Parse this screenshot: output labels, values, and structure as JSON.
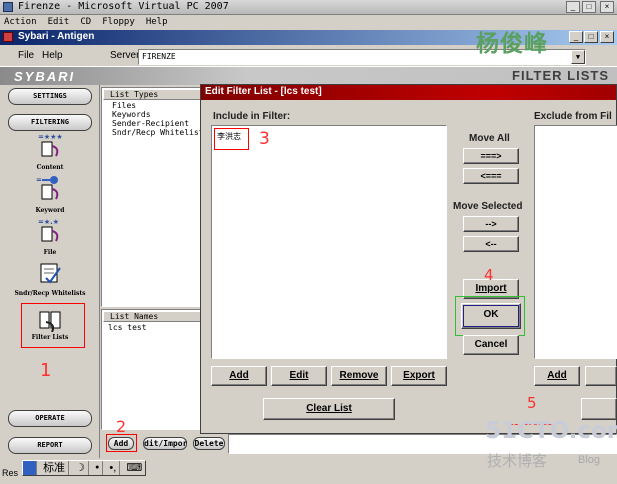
{
  "vpc": {
    "title": "Firenze - Microsoft Virtual PC 2007",
    "menu": [
      "Action",
      "Edit",
      "CD",
      "Floppy",
      "Help"
    ]
  },
  "app": {
    "title": "Sybari - Antigen",
    "menu": [
      "File",
      "Help"
    ],
    "server_label": "Server",
    "server_value": "FIRENZE",
    "brand": "SYBARI",
    "page_title": "FILTER LISTS"
  },
  "nav": {
    "settings": "SETTINGS",
    "filtering": "FILTERING",
    "items": [
      "Content",
      "Keyword",
      "File",
      "Sndr/Recp Whitelists",
      "Filter Lists"
    ],
    "operate": "OPERATE",
    "report": "REPORT"
  },
  "list_types": {
    "header": "List Types",
    "items": [
      "Files",
      "Keywords",
      "Sender-Recipient",
      "Sndr/Recp Whitelists"
    ]
  },
  "list_names": {
    "header": "List Names",
    "items": [
      "lcs test"
    ]
  },
  "bottom_buttons": [
    "Add",
    "dit/Impor",
    "Delete"
  ],
  "dialog": {
    "title": "Edit Filter List - [lcs test]",
    "include_label": "Include in Filter:",
    "include_items": [
      "李洪志"
    ],
    "exclude_label": "Exclude from Fil",
    "move_all_label": "Move All",
    "move_all_right": "===>",
    "move_all_left": "<===",
    "move_selected_label": "Move Selected",
    "move_selected_right": "-->",
    "move_selected_left": "<--",
    "import": "Import",
    "ok": "OK",
    "cancel": "Cancel",
    "include_buttons": [
      "Add",
      "Edit",
      "Remove",
      "Export"
    ],
    "clear_list": "Clear List",
    "exclude_add": "Add"
  },
  "annotations": [
    "1",
    "2",
    "3",
    "4",
    "5"
  ],
  "taskbar": {
    "start_fragment": "Res",
    "ime": [
      "标准",
      "●",
      "•,"
    ]
  },
  "watermark": {
    "cn_name": "杨俊峰",
    "site": "51CTO.com",
    "blog_cn": "技术博客",
    "blog": "Blog"
  }
}
